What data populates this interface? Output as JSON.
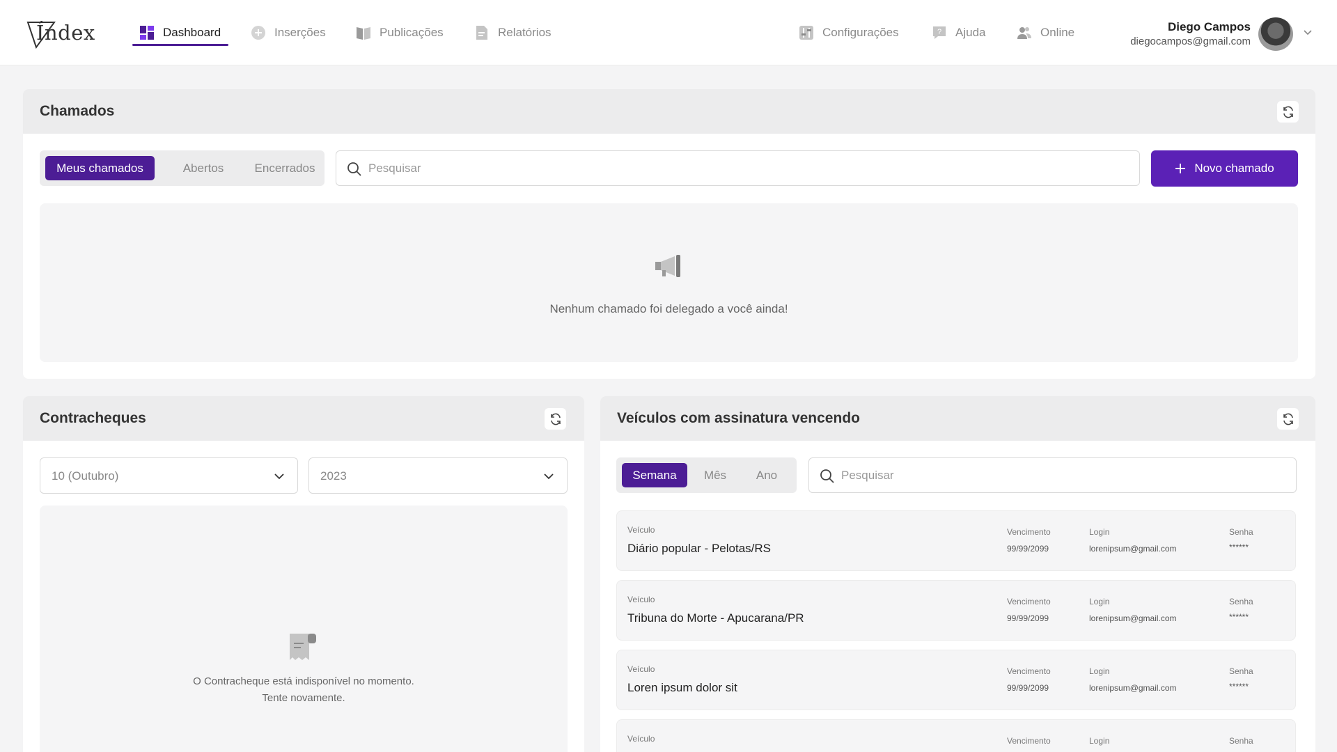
{
  "app": {
    "logo": "Índex"
  },
  "nav": {
    "items": [
      {
        "label": "Dashboard",
        "icon": "dashboard-icon",
        "active": true
      },
      {
        "label": "Inserções",
        "icon": "plus-circle-icon"
      },
      {
        "label": "Publicações",
        "icon": "book-icon"
      },
      {
        "label": "Relatórios",
        "icon": "document-icon"
      }
    ],
    "right": [
      {
        "label": "Configurações",
        "icon": "sliders-icon"
      },
      {
        "label": "Ajuda",
        "icon": "help-bubble-icon"
      },
      {
        "label": "Online",
        "icon": "users-icon"
      }
    ]
  },
  "user": {
    "name": "Diego Campos",
    "email": "diegocampos@gmail.com"
  },
  "chamados": {
    "title": "Chamados",
    "tabs": [
      "Meus chamados",
      "Abertos",
      "Encerrados"
    ],
    "active_tab": 0,
    "search_placeholder": "Pesquisar",
    "new_button": "Novo chamado",
    "empty_message": "Nenhum chamado foi delegado a você ainda!"
  },
  "contracheques": {
    "title": "Contracheques",
    "month": "10 (Outubro)",
    "year": "2023",
    "empty_line1": "O Contracheque está indisponível no momento.",
    "empty_line2": "Tente novamente."
  },
  "veiculos": {
    "title": "Veículos com assinatura vencendo",
    "tabs": [
      "Semana",
      "Mês",
      "Ano"
    ],
    "active_tab": 0,
    "search_placeholder": "Pesquisar",
    "labels": {
      "veiculo": "Veículo",
      "vencimento": "Vencimento",
      "login": "Login",
      "senha": "Senha"
    },
    "rows": [
      {
        "veiculo": "Diário popular - Pelotas/RS",
        "vencimento": "99/99/2099",
        "login": "lorenipsum@gmail.com",
        "senha": "******"
      },
      {
        "veiculo": "Tribuna do Morte - Apucarana/PR",
        "vencimento": "99/99/2099",
        "login": "lorenipsum@gmail.com",
        "senha": "******"
      },
      {
        "veiculo": "Loren ipsum dolor sit",
        "vencimento": "99/99/2099",
        "login": "lorenipsum@gmail.com",
        "senha": "******"
      },
      {
        "veiculo": "",
        "vencimento": "",
        "login": "",
        "senha": ""
      }
    ]
  },
  "colors": {
    "accent": "#4c1d95",
    "accent_button": "#5b21b6"
  }
}
